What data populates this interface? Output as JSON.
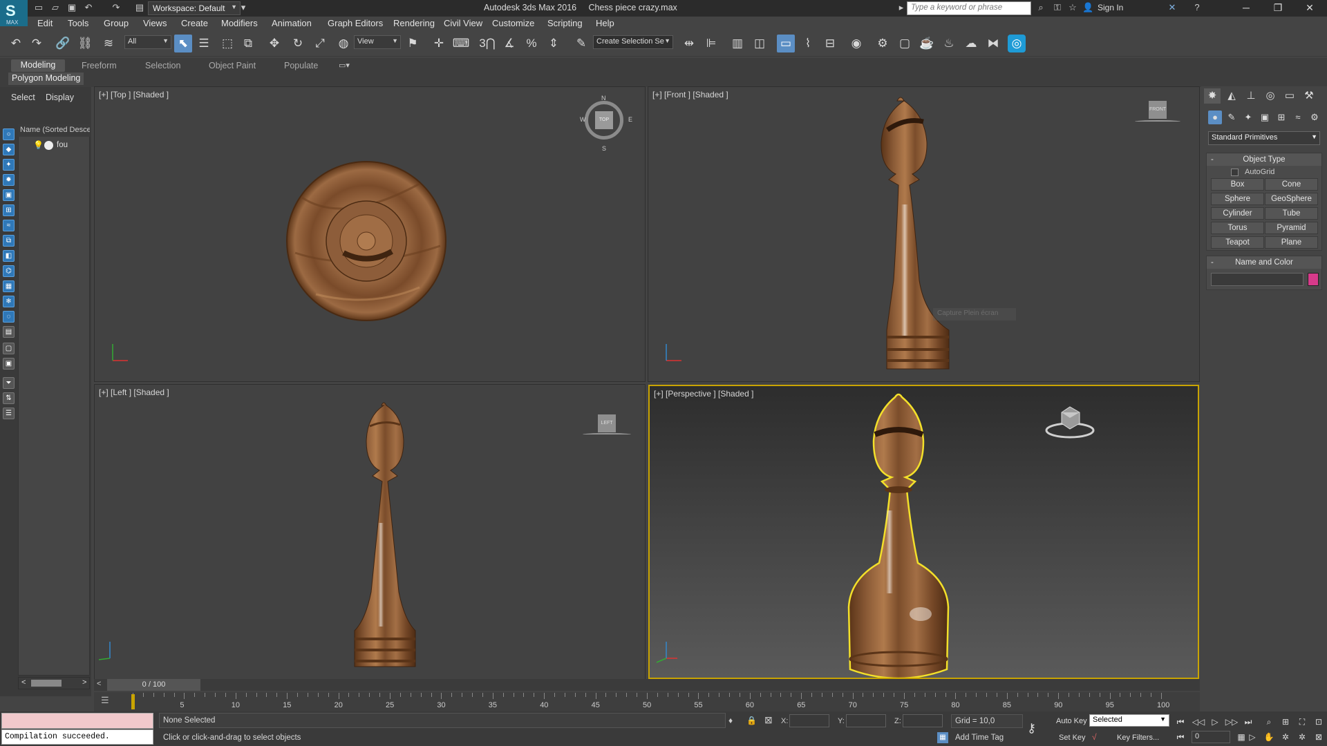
{
  "window": {
    "app_title": "Autodesk 3ds Max 2016",
    "file_name": "Chess piece crazy.max",
    "workspace": "Workspace: Default",
    "search_placeholder": "Type a keyword or phrase",
    "sign_in": "Sign In",
    "logo_text": "MAX"
  },
  "menu": [
    "Edit",
    "Tools",
    "Group",
    "Views",
    "Create",
    "Modifiers",
    "Animation",
    "Graph Editors",
    "Rendering",
    "Civil View",
    "Customize",
    "Scripting",
    "Help"
  ],
  "toolbar": {
    "filter_value": "All",
    "reference_coord": "View",
    "selection_set": "Create Selection Se",
    "snap_label": "3"
  },
  "ribbon": {
    "tabs": [
      "Modeling",
      "Freeform",
      "Selection",
      "Object Paint",
      "Populate"
    ],
    "active_tab": "Modeling",
    "panel_label": "Polygon Modeling"
  },
  "scene_explorer": {
    "tabs": [
      "Select",
      "Display"
    ],
    "column_header": "Name (Sorted Descending)",
    "objects": [
      "fou"
    ]
  },
  "viewports": {
    "top": "[+] [Top ] [Shaded ]",
    "front": "[+] [Front ] [Shaded ]",
    "left": "[+] [Left ] [Shaded ]",
    "perspective": "[+] [Perspective ] [Shaded ]",
    "compass": {
      "n": "N",
      "s": "S",
      "e": "E",
      "w": "W"
    },
    "cube_top": "TOP",
    "cube_front": "FRONT",
    "cube_left": "LEFT",
    "faint_tooltip": "Capture Plein écran"
  },
  "command_panel": {
    "category": "Standard Primitives",
    "object_type_title": "Object Type",
    "autogrid": "AutoGrid",
    "primitives": [
      "Box",
      "Cone",
      "Sphere",
      "GeoSphere",
      "Cylinder",
      "Tube",
      "Torus",
      "Pyramid",
      "Teapot",
      "Plane"
    ],
    "name_color_title": "Name and Color",
    "object_color": "#d63a8a"
  },
  "timeline": {
    "slider_text": "0 / 100",
    "current_frame": 0,
    "ticks": [
      "5",
      "10",
      "15",
      "20",
      "25",
      "30",
      "35",
      "40",
      "45",
      "50",
      "55",
      "60",
      "65",
      "70",
      "75",
      "80",
      "85",
      "90",
      "95",
      "100"
    ]
  },
  "status": {
    "maxscript_output": "Compilation succeeded.",
    "selection": "None Selected",
    "prompt": "Click or click-and-drag to select objects",
    "x_label": "X:",
    "y_label": "Y:",
    "z_label": "Z:",
    "grid": "Grid = 10,0",
    "auto_key": "Auto Key",
    "set_key": "Set Key",
    "key_mode": "Selected",
    "key_filters": "Key Filters...",
    "add_time_tag": "Add Time Tag",
    "frame_value": "0"
  },
  "colors": {
    "accent_blue": "#5b8ec4",
    "selection_yellow": "#c9a400",
    "wood": "#8a5a36"
  }
}
